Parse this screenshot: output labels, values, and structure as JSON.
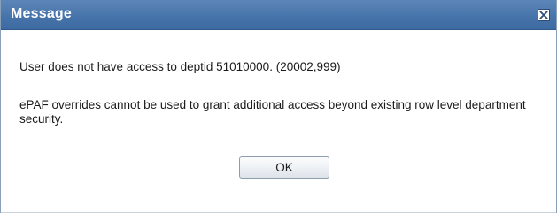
{
  "dialog": {
    "title": "Message",
    "close_icon": "close-icon",
    "message_line_1": "User does not have access to deptid 51010000. (20002,999)",
    "message_line_2": "ePAF overrides cannot be used to grant additional access beyond existing row level department security.",
    "ok_label": "OK"
  },
  "colors": {
    "titlebar": "#4775ab",
    "title_text": "#ffffff",
    "body_text": "#1a1a1a"
  }
}
